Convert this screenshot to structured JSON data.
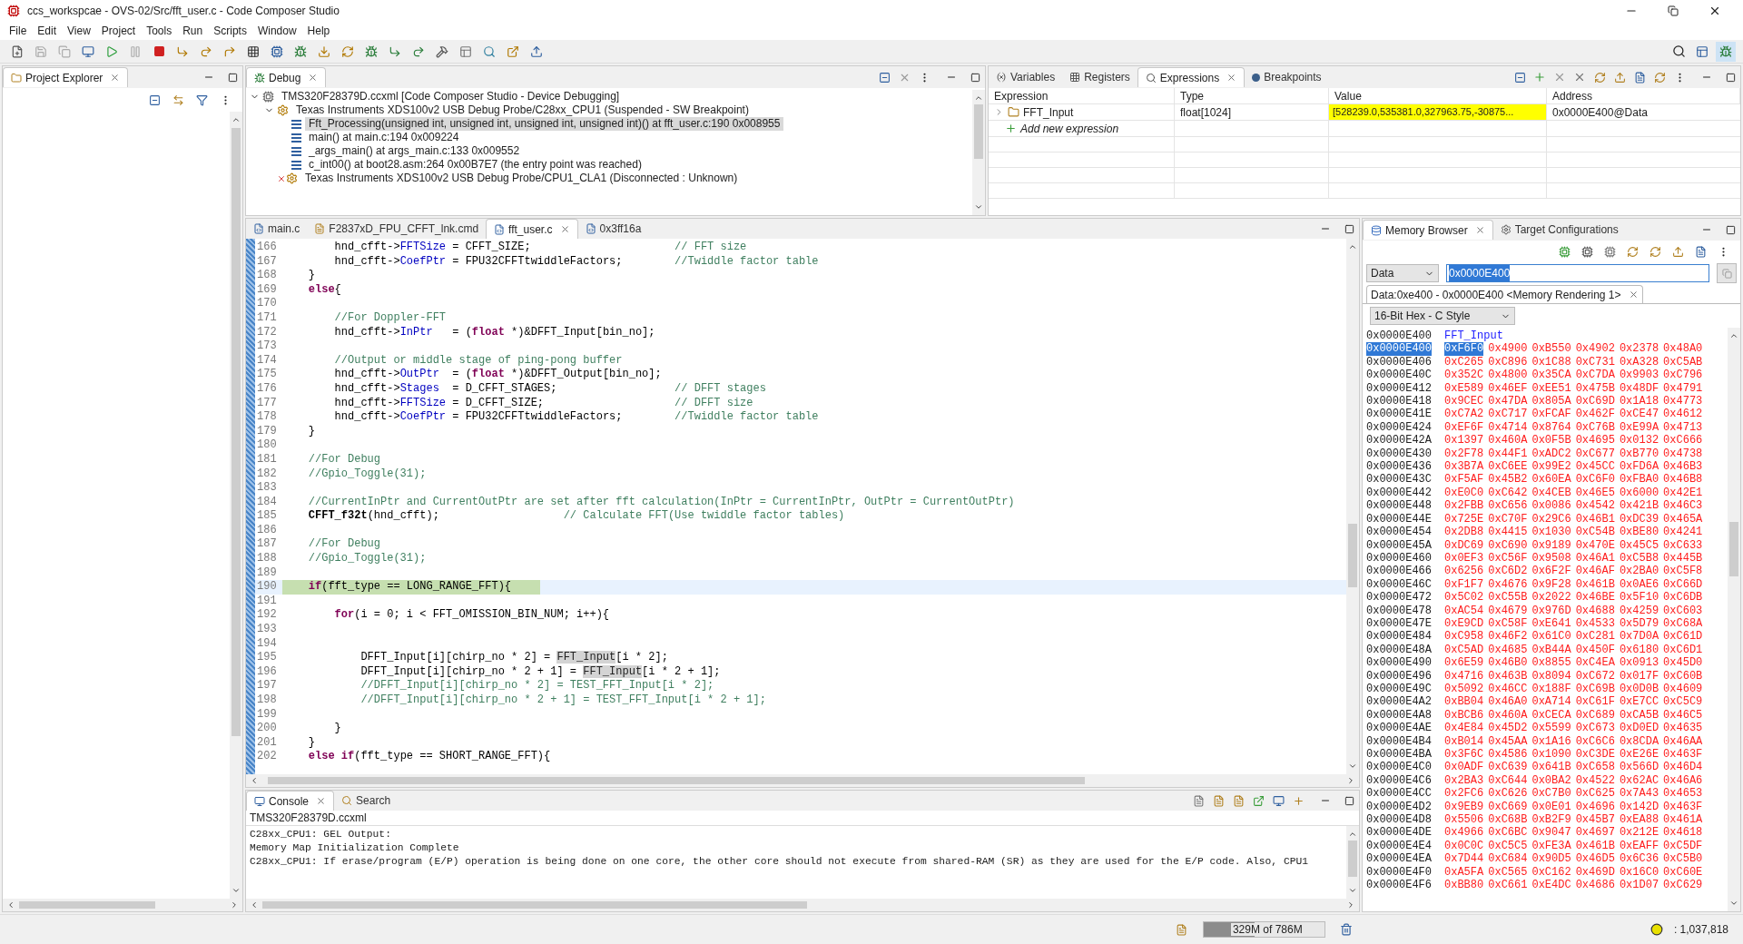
{
  "window": {
    "title": "ccs_workspcae - OVS-02/Src/fft_user.c - Code Composer Studio"
  },
  "menu": [
    "File",
    "Edit",
    "View",
    "Project",
    "Tools",
    "Run",
    "Scripts",
    "Window",
    "Help"
  ],
  "project_explorer": {
    "tab": {
      "label": "Project Explorer",
      "selected": true
    }
  },
  "debug": {
    "tab": {
      "label": "Debug",
      "selected": true
    },
    "tree": [
      {
        "kind": "device",
        "label": "TMS320F28379D.ccxml [Code Composer Studio - Device Debugging]",
        "expanded": true,
        "selected": false,
        "children": [
          {
            "kind": "probe",
            "label": "Texas Instruments XDS100v2 USB Debug Probe/C28xx_CPU1 (Suspended - SW Breakpoint)",
            "expanded": true,
            "selected": false,
            "children": [
              {
                "kind": "frame",
                "label": "Fft_Processing(unsigned int, unsigned int, unsigned int, unsigned int)() at fft_user.c:190 0x008955",
                "selected": true
              },
              {
                "kind": "frame",
                "label": "main() at main.c:194 0x009224",
                "selected": false
              },
              {
                "kind": "frame",
                "label": "_args_main() at args_main.c:133 0x009552",
                "selected": false
              },
              {
                "kind": "frame",
                "label": "c_int00() at boot28.asm:264 0x00B7E7  (the entry point was reached)",
                "selected": false
              }
            ]
          },
          {
            "kind": "disconnected",
            "label": "Texas Instruments XDS100v2 USB Debug Probe/CPU1_CLA1 (Disconnected : Unknown)",
            "selected": false
          }
        ]
      }
    ]
  },
  "expressions": {
    "tabs": [
      {
        "kind": "variables",
        "label": "Variables",
        "selected": false
      },
      {
        "kind": "registers",
        "label": "Registers",
        "selected": false
      },
      {
        "kind": "expressions",
        "label": "Expressions",
        "selected": true
      },
      {
        "kind": "breakpoints",
        "label": "Breakpoints",
        "selected": false
      }
    ],
    "columns": [
      "Expression",
      "Type",
      "Value",
      "Address"
    ],
    "rows": [
      {
        "expression": "FFT_Input",
        "type": "float[1024]",
        "value": "[528239.0,535381.0,327963.75,-30875...",
        "changed": true,
        "address": "0x0000E400@Data"
      }
    ],
    "add_new": "Add new expression"
  },
  "editor": {
    "tabs": [
      {
        "kind": "c",
        "label": "main.c",
        "selected": false
      },
      {
        "kind": "cmd",
        "label": "F2837xD_FPU_CFFT_lnk.cmd",
        "selected": false
      },
      {
        "kind": "c",
        "label": "fft_user.c",
        "selected": true
      },
      {
        "kind": "c",
        "label": "0x3ff16a",
        "selected": false
      }
    ],
    "lines": [
      {
        "number": "166",
        "tokens": [
          {
            "kind": "plain",
            "text": "        hnd_cfft->"
          },
          {
            "kind": "field",
            "text": "FFTSize"
          },
          {
            "kind": "plain",
            "text": " = CFFT_SIZE;                      "
          },
          {
            "kind": "comment",
            "text": "// FFT size"
          }
        ]
      },
      {
        "number": "167",
        "tokens": [
          {
            "kind": "plain",
            "text": "        hnd_cfft->"
          },
          {
            "kind": "field",
            "text": "CoefPtr"
          },
          {
            "kind": "plain",
            "text": " = FPU32CFFTtwiddleFactors;        "
          },
          {
            "kind": "comment",
            "text": "//Twiddle factor table"
          }
        ]
      },
      {
        "number": "168",
        "tokens": [
          {
            "kind": "plain",
            "text": "    }"
          }
        ]
      },
      {
        "number": "169",
        "tokens": [
          {
            "kind": "keyword",
            "text": "    else"
          },
          {
            "kind": "plain",
            "text": "{"
          }
        ]
      },
      {
        "number": "170"
      },
      {
        "number": "171",
        "tokens": [
          {
            "kind": "comment",
            "text": "        //For Doppler-FFT"
          }
        ]
      },
      {
        "number": "172",
        "tokens": [
          {
            "kind": "plain",
            "text": "        hnd_cfft->"
          },
          {
            "kind": "field",
            "text": "InPtr"
          },
          {
            "kind": "plain",
            "text": "   = ("
          },
          {
            "kind": "keyword",
            "text": "float"
          },
          {
            "kind": "plain",
            "text": " *)&DFFT_Input[bin_no];"
          }
        ]
      },
      {
        "number": "173"
      },
      {
        "number": "174",
        "tokens": [
          {
            "kind": "comment",
            "text": "        //Output or middle stage of ping-pong buffer"
          }
        ]
      },
      {
        "number": "175",
        "tokens": [
          {
            "kind": "plain",
            "text": "        hnd_cfft->"
          },
          {
            "kind": "field",
            "text": "OutPtr"
          },
          {
            "kind": "plain",
            "text": "  = ("
          },
          {
            "kind": "keyword",
            "text": "float"
          },
          {
            "kind": "plain",
            "text": " *)&DFFT_Output[bin_no];"
          }
        ]
      },
      {
        "number": "176",
        "tokens": [
          {
            "kind": "plain",
            "text": "        hnd_cfft->"
          },
          {
            "kind": "field",
            "text": "Stages"
          },
          {
            "kind": "plain",
            "text": "  = D_CFFT_STAGES;                  "
          },
          {
            "kind": "comment",
            "text": "// DFFT stages"
          }
        ]
      },
      {
        "number": "177",
        "tokens": [
          {
            "kind": "plain",
            "text": "        hnd_cfft->"
          },
          {
            "kind": "field",
            "text": "FFTSize"
          },
          {
            "kind": "plain",
            "text": " = D_CFFT_SIZE;                    "
          },
          {
            "kind": "comment",
            "text": "// DFFT size"
          }
        ]
      },
      {
        "number": "178",
        "tokens": [
          {
            "kind": "plain",
            "text": "        hnd_cfft->"
          },
          {
            "kind": "field",
            "text": "CoefPtr"
          },
          {
            "kind": "plain",
            "text": " = FPU32CFFTtwiddleFactors;        "
          },
          {
            "kind": "comment",
            "text": "//Twiddle factor table"
          }
        ]
      },
      {
        "number": "179",
        "tokens": [
          {
            "kind": "plain",
            "text": "    }"
          }
        ]
      },
      {
        "number": "180"
      },
      {
        "number": "181",
        "tokens": [
          {
            "kind": "comment",
            "text": "    //For Debug"
          }
        ]
      },
      {
        "number": "182",
        "tokens": [
          {
            "kind": "comment",
            "text": "    //Gpio_Toggle(31);"
          }
        ]
      },
      {
        "number": "183"
      },
      {
        "number": "184",
        "tokens": [
          {
            "kind": "comment",
            "text": "    //CurrentInPtr and CurrentOutPtr are set after fft calculation(InPtr = CurrentInPtr, OutPtr = CurrentOutPtr)"
          }
        ]
      },
      {
        "number": "185",
        "tokens": [
          {
            "kind": "function",
            "text": "    CFFT_f32t"
          },
          {
            "kind": "plain",
            "text": "(hnd_cfft);                   "
          },
          {
            "kind": "comment",
            "text": "// Calculate FFT(Use twiddle factor tables)"
          }
        ]
      },
      {
        "number": "186"
      },
      {
        "number": "187",
        "tokens": [
          {
            "kind": "comment",
            "text": "    //For Debug"
          }
        ]
      },
      {
        "number": "188",
        "tokens": [
          {
            "kind": "comment",
            "text": "    //Gpio_Toggle(31);"
          }
        ]
      },
      {
        "number": "189"
      },
      {
        "number": "190",
        "current": true,
        "tokens": [
          {
            "kind": "keyword",
            "text": "    if"
          },
          {
            "kind": "plain",
            "text": "(fft_type == LONG_RANGE_FFT){"
          }
        ]
      },
      {
        "number": "191"
      },
      {
        "number": "192",
        "tokens": [
          {
            "kind": "keyword",
            "text": "        for"
          },
          {
            "kind": "plain",
            "text": "(i = 0; i < FFT_OMISSION_BIN_NUM; i++){"
          }
        ]
      },
      {
        "number": "193"
      },
      {
        "number": "194"
      },
      {
        "number": "195",
        "tokens": [
          {
            "kind": "plain",
            "text": "            DFFT_Input[i][chirp_no * 2] = "
          },
          {
            "kind": "occurrence",
            "text": "FFT_Input"
          },
          {
            "kind": "plain",
            "text": "[i * 2];"
          }
        ]
      },
      {
        "number": "196",
        "tokens": [
          {
            "kind": "plain",
            "text": "            DFFT_Input[i][chirp_no * 2 + 1] = "
          },
          {
            "kind": "occurrence",
            "text": "FFT_Input"
          },
          {
            "kind": "plain",
            "text": "[i * 2 + 1];"
          }
        ]
      },
      {
        "number": "197",
        "tokens": [
          {
            "kind": "comment",
            "text": "            //DFFT_Input[i][chirp_no * 2] = TEST_FFT_Input[i * 2];"
          }
        ]
      },
      {
        "number": "198",
        "tokens": [
          {
            "kind": "comment",
            "text": "            //DFFT_Input[i][chirp_no * 2 + 1] = TEST_FFT_Input[i * 2 + 1];"
          }
        ]
      },
      {
        "number": "199"
      },
      {
        "number": "200",
        "tokens": [
          {
            "kind": "plain",
            "text": "        }"
          }
        ]
      },
      {
        "number": "201",
        "tokens": [
          {
            "kind": "plain",
            "text": "    }"
          }
        ]
      },
      {
        "number": "202",
        "tokens": [
          {
            "kind": "keyword",
            "text": "    else if"
          },
          {
            "kind": "plain",
            "text": "(fft_type == SHORT_RANGE_FFT){"
          }
        ]
      }
    ]
  },
  "console": {
    "tabs": [
      {
        "kind": "console",
        "label": "Console",
        "selected": true
      },
      {
        "kind": "search",
        "label": "Search",
        "selected": false
      }
    ],
    "source": "TMS320F28379D.ccxml",
    "lines": [
      "C28xx_CPU1: GEL Output:",
      "Memory Map Initialization Complete",
      "C28xx_CPU1: If erase/program (E/P) operation is being done on one core, the other core should not execute from shared-RAM (SR) as they are used for the E/P code. Also, CPU1"
    ]
  },
  "memory": {
    "tabs": [
      {
        "kind": "memory",
        "label": "Memory Browser",
        "selected": true
      },
      {
        "kind": "target",
        "label": "Target Configurations",
        "selected": false
      }
    ],
    "page": "Data",
    "address": "0x0000E400",
    "rendering_tab": "Data:0xe400 - 0x0000E400 <Memory Rendering 1>",
    "format": "16-Bit Hex - C Style",
    "label_row": {
      "address": "0x0000E400",
      "label": "FFT_Input"
    },
    "rows": [
      {
        "address": "0x0000E400",
        "selected": true,
        "values": [
          "0xF6F0",
          "0x4900",
          "0xB550",
          "0x4902",
          "0x2378",
          "0x48A0"
        ]
      },
      {
        "address": "0x0000E406",
        "selected": false,
        "values": [
          "0xC265",
          "0xC896",
          "0x1C88",
          "0xC731",
          "0xA328",
          "0xC5AB"
        ]
      },
      {
        "address": "0x0000E40C",
        "selected": false,
        "values": [
          "0x352C",
          "0x4800",
          "0x35CA",
          "0xC7DA",
          "0x9903",
          "0xC796"
        ]
      },
      {
        "address": "0x0000E412",
        "selected": false,
        "values": [
          "0xE589",
          "0x46EF",
          "0xEE51",
          "0x475B",
          "0x48DF",
          "0x4791"
        ]
      },
      {
        "address": "0x0000E418",
        "selected": false,
        "values": [
          "0x9CEC",
          "0x47DA",
          "0x805A",
          "0xC69D",
          "0x1A18",
          "0x4773"
        ]
      },
      {
        "address": "0x0000E41E",
        "selected": false,
        "values": [
          "0xC7A2",
          "0xC717",
          "0xFCAF",
          "0x462F",
          "0xCE47",
          "0x4612"
        ]
      },
      {
        "address": "0x0000E424",
        "selected": false,
        "values": [
          "0xEF6F",
          "0x4714",
          "0x8764",
          "0xC76B",
          "0xE99A",
          "0x4713"
        ]
      },
      {
        "address": "0x0000E42A",
        "selected": false,
        "values": [
          "0x1397",
          "0x460A",
          "0x0F5B",
          "0x4695",
          "0x0132",
          "0xC666"
        ]
      },
      {
        "address": "0x0000E430",
        "selected": false,
        "values": [
          "0x2F78",
          "0x44F1",
          "0xADC2",
          "0xC677",
          "0xB770",
          "0x4738"
        ]
      },
      {
        "address": "0x0000E436",
        "selected": false,
        "values": [
          "0x3B7A",
          "0xC6EE",
          "0x99E2",
          "0x45CC",
          "0xFD6A",
          "0x46B3"
        ]
      },
      {
        "address": "0x0000E43C",
        "selected": false,
        "values": [
          "0xF5AF",
          "0x45B2",
          "0x60EA",
          "0xC6F0",
          "0xFBA0",
          "0x46B8"
        ]
      },
      {
        "address": "0x0000E442",
        "selected": false,
        "values": [
          "0xE0C0",
          "0xC642",
          "0x4CEB",
          "0x46E5",
          "0x6000",
          "0x42E1"
        ]
      },
      {
        "address": "0x0000E448",
        "selected": false,
        "values": [
          "0x2FBB",
          "0xC656",
          "0x0086",
          "0x4542",
          "0x421B",
          "0x46C3"
        ]
      },
      {
        "address": "0x0000E44E",
        "selected": false,
        "values": [
          "0x725E",
          "0xC70F",
          "0x29C6",
          "0x46B1",
          "0xDC39",
          "0x465A"
        ]
      },
      {
        "address": "0x0000E454",
        "selected": false,
        "values": [
          "0x2DB8",
          "0x4415",
          "0x1030",
          "0xC54B",
          "0xBE80",
          "0x4241"
        ]
      },
      {
        "address": "0x0000E45A",
        "selected": false,
        "values": [
          "0xDC69",
          "0xC690",
          "0x9189",
          "0x470E",
          "0x45C5",
          "0xC633"
        ]
      },
      {
        "address": "0x0000E460",
        "selected": false,
        "values": [
          "0x0EF3",
          "0xC56F",
          "0x9508",
          "0x46A1",
          "0xC5B8",
          "0x445B"
        ]
      },
      {
        "address": "0x0000E466",
        "selected": false,
        "values": [
          "0x6256",
          "0xC6D2",
          "0x6F2F",
          "0x46AF",
          "0x2BA0",
          "0xC5F8"
        ]
      },
      {
        "address": "0x0000E46C",
        "selected": false,
        "values": [
          "0xF1F7",
          "0x4676",
          "0x9F28",
          "0x461B",
          "0x0AE6",
          "0xC66D"
        ]
      },
      {
        "address": "0x0000E472",
        "selected": false,
        "values": [
          "0x5C02",
          "0xC55B",
          "0x2022",
          "0x46BE",
          "0x5F10",
          "0xC6DB"
        ]
      },
      {
        "address": "0x0000E478",
        "selected": false,
        "values": [
          "0xAC54",
          "0x4679",
          "0x976D",
          "0x4688",
          "0x4259",
          "0xC603"
        ]
      },
      {
        "address": "0x0000E47E",
        "selected": false,
        "values": [
          "0xE9CD",
          "0xC58F",
          "0xE641",
          "0x4533",
          "0x5D79",
          "0xC68A"
        ]
      },
      {
        "address": "0x0000E484",
        "selected": false,
        "values": [
          "0xC958",
          "0x46F2",
          "0x61C0",
          "0xC281",
          "0x7D0A",
          "0xC61D"
        ]
      },
      {
        "address": "0x0000E48A",
        "selected": false,
        "values": [
          "0xC5AD",
          "0x4685",
          "0xB44A",
          "0x450F",
          "0x6180",
          "0xC6D1"
        ]
      },
      {
        "address": "0x0000E490",
        "selected": false,
        "values": [
          "0x6E59",
          "0x46B0",
          "0x8855",
          "0xC4EA",
          "0x0913",
          "0x45D0"
        ]
      },
      {
        "address": "0x0000E496",
        "selected": false,
        "values": [
          "0x4716",
          "0x463B",
          "0x8094",
          "0xC672",
          "0x017F",
          "0xC60B"
        ]
      },
      {
        "address": "0x0000E49C",
        "selected": false,
        "values": [
          "0x5092",
          "0x46CC",
          "0x188F",
          "0xC69B",
          "0x0D0B",
          "0x4609"
        ]
      },
      {
        "address": "0x0000E4A2",
        "selected": false,
        "values": [
          "0xBB04",
          "0x46A0",
          "0xA714",
          "0xC61F",
          "0xE7CC",
          "0xC5C9"
        ]
      },
      {
        "address": "0x0000E4A8",
        "selected": false,
        "values": [
          "0xBCB6",
          "0x460A",
          "0xCECA",
          "0xC689",
          "0xCA5B",
          "0x46C5"
        ]
      },
      {
        "address": "0x0000E4AE",
        "selected": false,
        "values": [
          "0x4E84",
          "0x45D2",
          "0x5599",
          "0xC673",
          "0xD0ED",
          "0x4635"
        ]
      },
      {
        "address": "0x0000E4B4",
        "selected": false,
        "values": [
          "0xB014",
          "0x45AA",
          "0x1A16",
          "0xC6C6",
          "0x8CDA",
          "0x46AA"
        ]
      },
      {
        "address": "0x0000E4BA",
        "selected": false,
        "values": [
          "0x3F6C",
          "0x4586",
          "0x1090",
          "0xC3DE",
          "0xE26E",
          "0x463F"
        ]
      },
      {
        "address": "0x0000E4C0",
        "selected": false,
        "values": [
          "0x0ADF",
          "0xC639",
          "0x641B",
          "0xC658",
          "0x566D",
          "0x46D4"
        ]
      },
      {
        "address": "0x0000E4C6",
        "selected": false,
        "values": [
          "0x2BA3",
          "0xC644",
          "0x0BA2",
          "0x4522",
          "0x62AC",
          "0x46A6"
        ]
      },
      {
        "address": "0x0000E4CC",
        "selected": false,
        "values": [
          "0x2FC6",
          "0xC626",
          "0xC7B0",
          "0xC625",
          "0x7A43",
          "0x4653"
        ]
      },
      {
        "address": "0x0000E4D2",
        "selected": false,
        "values": [
          "0x9EB9",
          "0xC669",
          "0x0E01",
          "0x4696",
          "0x142D",
          "0x463F"
        ]
      },
      {
        "address": "0x0000E4D8",
        "selected": false,
        "values": [
          "0x5506",
          "0xC68B",
          "0xB2F9",
          "0x45B7",
          "0xEA88",
          "0x461A"
        ]
      },
      {
        "address": "0x0000E4DE",
        "selected": false,
        "values": [
          "0x4966",
          "0xC6BC",
          "0x9047",
          "0x4697",
          "0x212E",
          "0x4618"
        ]
      },
      {
        "address": "0x0000E4E4",
        "selected": false,
        "values": [
          "0x0C0C",
          "0xC5C5",
          "0xFE3A",
          "0x461B",
          "0xEAFF",
          "0xC5DF"
        ]
      },
      {
        "address": "0x0000E4EA",
        "selected": false,
        "values": [
          "0x7D44",
          "0xC684",
          "0x90D5",
          "0x46D5",
          "0x6C36",
          "0xC5B0"
        ]
      },
      {
        "address": "0x0000E4F0",
        "selected": false,
        "values": [
          "0xA5FA",
          "0xC565",
          "0xC162",
          "0x469D",
          "0x16C0",
          "0xC60E"
        ]
      },
      {
        "address": "0x0000E4F6",
        "selected": false,
        "values": [
          "0xBB80",
          "0xC661",
          "0xE4DC",
          "0x4686",
          "0x1D07",
          "0xC629"
        ]
      }
    ]
  },
  "status_bar": {
    "heap": {
      "text": "329M of 786M",
      "level": 0.42
    },
    "cycles": ": 1,037,818"
  }
}
